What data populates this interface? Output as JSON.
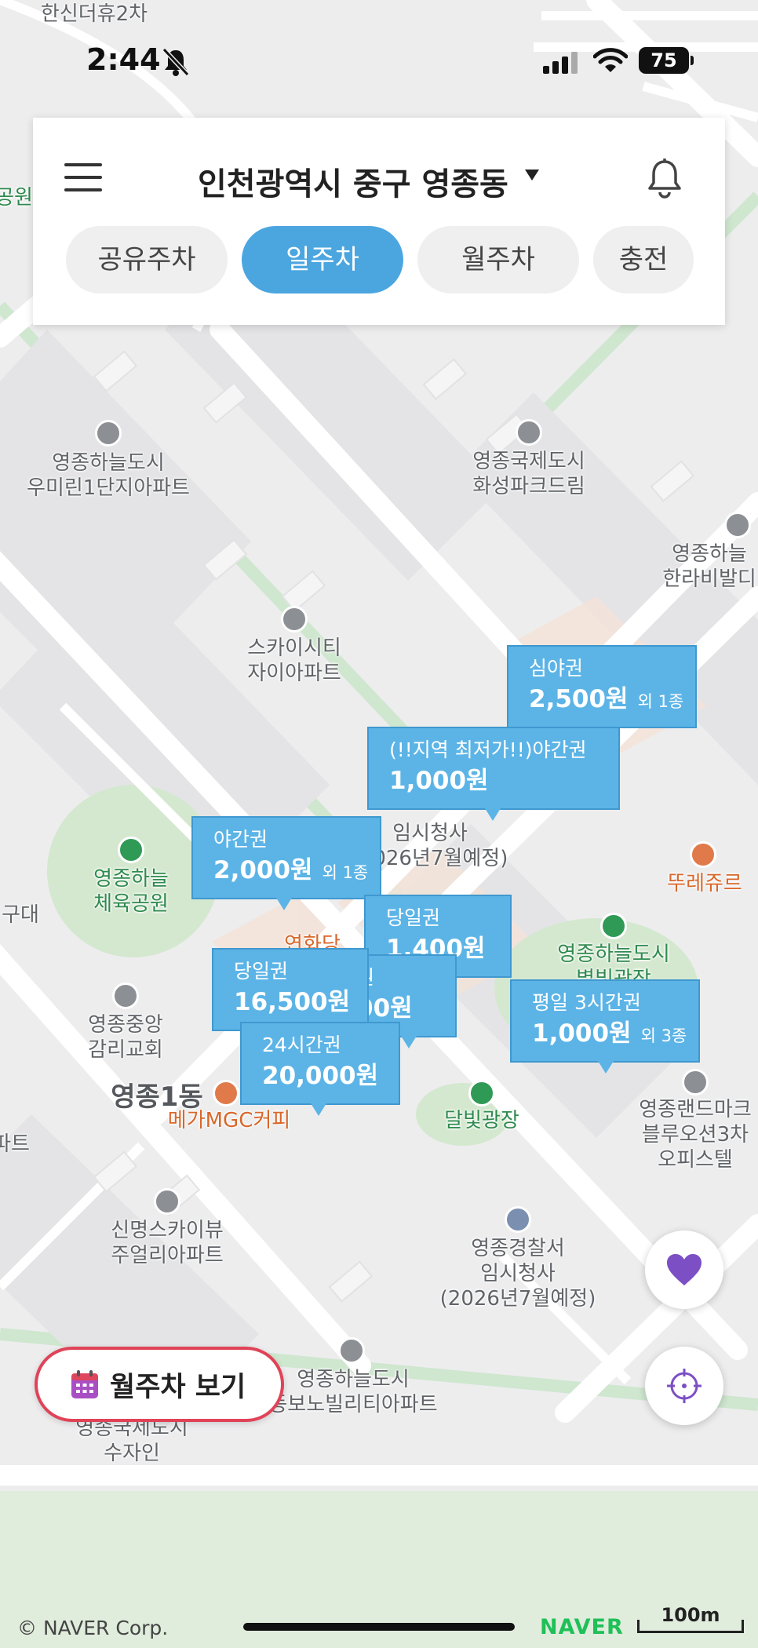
{
  "status_bar": {
    "time": "2:44",
    "battery": "75"
  },
  "header": {
    "region": "인천광역시 중구 영종동",
    "tabs": [
      {
        "label": "공유주차",
        "active": false
      },
      {
        "label": "일주차",
        "active": true
      },
      {
        "label": "월주차",
        "active": false
      },
      {
        "label": "충전",
        "active": false
      }
    ]
  },
  "map_labels": {
    "top_apt": "한신더휴2차",
    "left_park": "공원",
    "woomirin": "영종하늘도시\n우미린1단지아파트",
    "hwaseong": "영종국제도시\n화성파크드림",
    "hanra": "영종하늘\n한라비발디",
    "xi": "스카이시티\n자이아파트",
    "office": "임시청사\n(2026년7월예정)",
    "ttore": "뚜레쥬르",
    "sports_park": "영종하늘\n체육공원",
    "gu": "구대",
    "yeonhwa": "연화당",
    "neighborhood_park": "영종하늘도시\n별빛광장",
    "church": "영종중앙\n감리교회",
    "dong": "영종1동",
    "mega": "메가MGC커피",
    "dalbit": "달빛광장",
    "landmark": "영종랜드마크\n블루오션3차\n오피스텔",
    "skyview": "신명스카이뷰\n주얼리아파트",
    "police": "영종경찰서\n임시청사\n(2026년7월예정)",
    "ebono": "영종하늘도시\n동보노빌리티아파트",
    "suja": "영종국제도시\n수자인",
    "left_edge": "파트"
  },
  "bubbles": [
    {
      "name": "심야권",
      "price": "2,500원",
      "extra": "외 1종"
    },
    {
      "name": "(!!지역 최저가!!)야간권",
      "price": "1,000원",
      "extra": ""
    },
    {
      "name": "야간권",
      "price": "2,000원",
      "extra": "외 1종"
    },
    {
      "name": "당일권",
      "price": "1,400원",
      "extra": ""
    },
    {
      "name": "당일권",
      "price": "16,500원",
      "extra": ""
    },
    {
      "name": "권",
      "price": "00원",
      "extra": ""
    },
    {
      "name": "평일 3시간권",
      "price": "1,000원",
      "extra": "외 3종"
    },
    {
      "name": "24시간권",
      "price": "20,000원",
      "extra": ""
    }
  ],
  "monthly_button": {
    "label": "월주차 보기"
  },
  "footer": {
    "copyright": "© NAVER Corp.",
    "logo": "NAVER",
    "scale": "100m"
  },
  "colors": {
    "accent": "#4ba6e0",
    "bubble": "#5cb4e6",
    "highlight_border": "#e04358",
    "favorite": "#7d4fc4"
  }
}
